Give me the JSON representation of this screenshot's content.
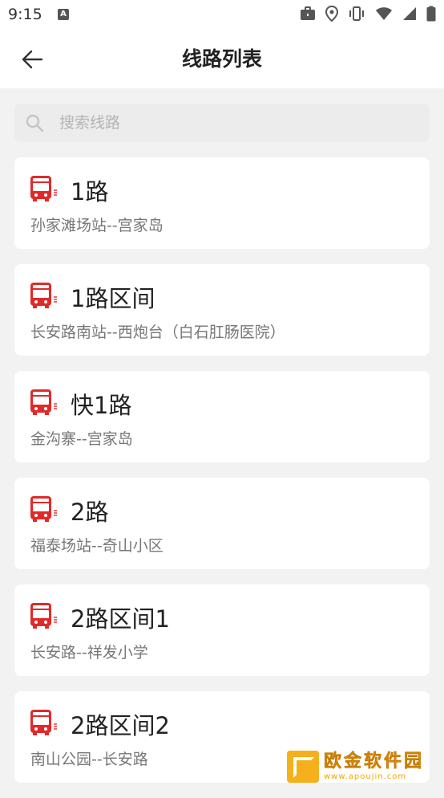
{
  "status_bar": {
    "time": "9:15",
    "notification_icon": "a-box-icon",
    "icons": [
      "briefcase-icon",
      "location-icon",
      "vibrate-icon",
      "wifi-icon",
      "signal-icon",
      "battery-icon"
    ]
  },
  "header": {
    "title": "线路列表",
    "back_icon": "arrow-left-icon"
  },
  "search": {
    "placeholder": "搜索线路",
    "value": ""
  },
  "routes": [
    {
      "name": "1路",
      "desc": "孙家滩场站--宫家岛"
    },
    {
      "name": "1路区间",
      "desc": "长安路南站--西炮台（白石肛肠医院）"
    },
    {
      "name": "快1路",
      "desc": "金沟寨--宫家岛"
    },
    {
      "name": "2路",
      "desc": "福泰场站--奇山小区"
    },
    {
      "name": "2路区间1",
      "desc": "长安路--祥发小学"
    },
    {
      "name": "2路区间2",
      "desc": "南山公园--长安路"
    }
  ],
  "colors": {
    "accent": "#e02a2a",
    "background": "#f2f2f2",
    "card": "#ffffff",
    "title_text": "#222222",
    "secondary_text": "#777777",
    "placeholder": "#b4b4b4"
  },
  "watermark": {
    "title": "欧金软件园",
    "url": "www.apoujin.com"
  }
}
